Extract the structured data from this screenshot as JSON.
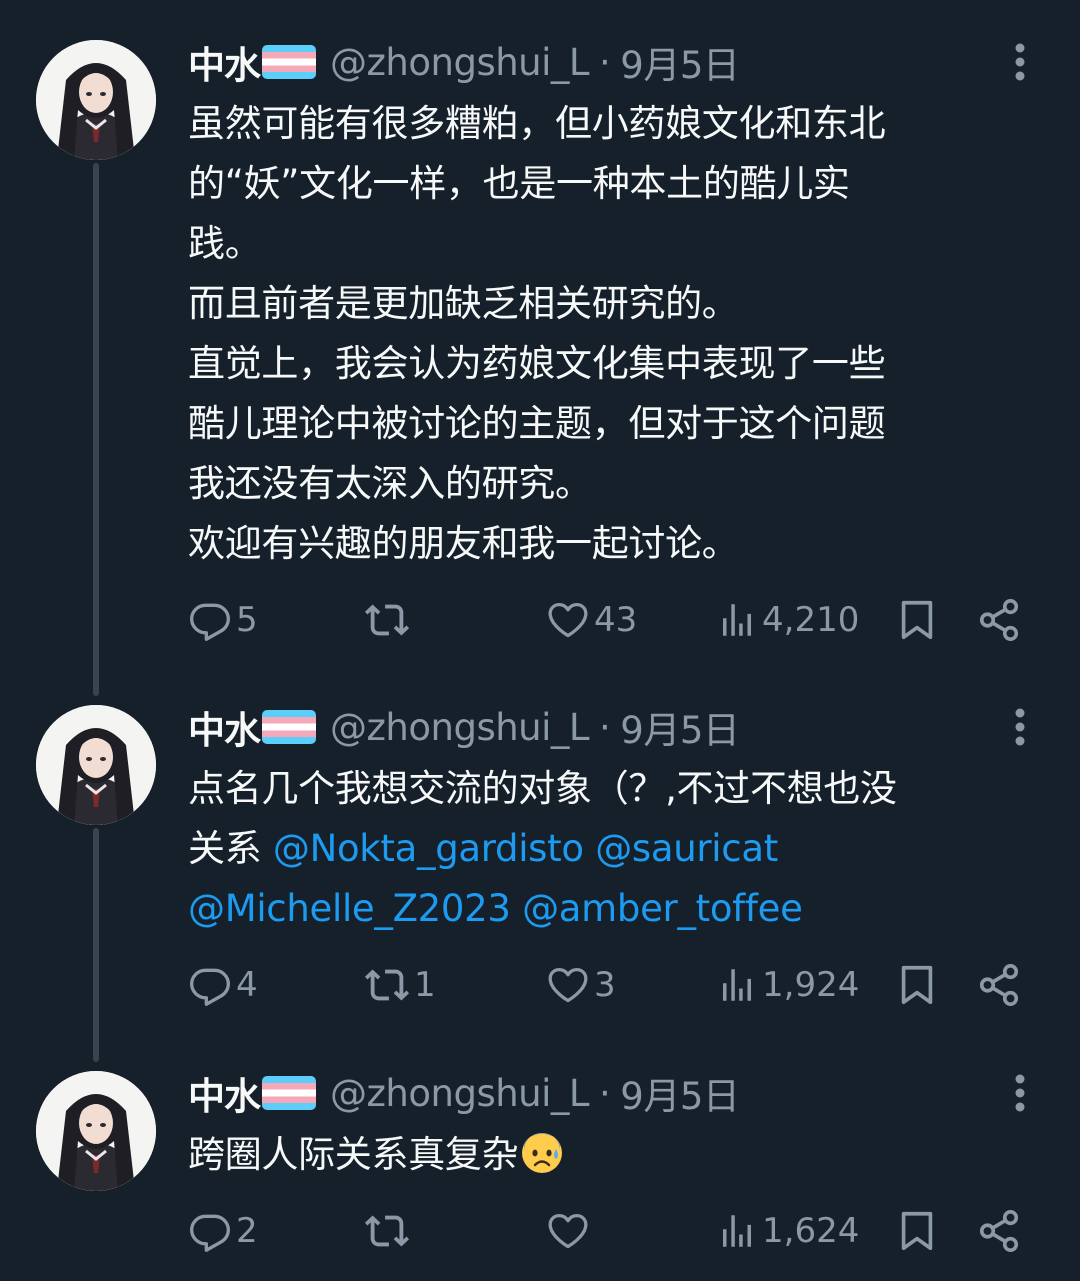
{
  "tweets": [
    {
      "author": {
        "name": "中水",
        "handle": "@zhongshui_L",
        "separator": "·",
        "date": "9月5日",
        "flag_icon": "transgender-flag-icon"
      },
      "lines": [
        "虽然可能有很多糟粕，但小药娘文化和东北",
        "的“妖”文化一样，也是一种本土的酷儿实",
        "践。",
        "而且前者是更加缺乏相关研究的。",
        "直觉上，我会认为药娘文化集中表现了一些",
        "酷儿理论中被讨论的主题，但对于这个问题",
        "我还没有太深入的研究。",
        "欢迎有兴趣的朋友和我一起讨论。"
      ],
      "stats": {
        "replies": "5",
        "retweets": "",
        "likes": "43",
        "views": "4,210"
      }
    },
    {
      "author": {
        "name": "中水",
        "handle": "@zhongshui_L",
        "separator": "·",
        "date": "9月5日",
        "flag_icon": "transgender-flag-icon"
      },
      "line1": "点名几个我想交流的对象（？,不过不想也没",
      "line2_prefix": "关系 ",
      "mentions": [
        "@Nokta_gardisto",
        "@sauricat",
        "@Michelle_Z2023",
        "@amber_toffee"
      ],
      "stats": {
        "replies": "4",
        "retweets": "1",
        "likes": "3",
        "views": "1,924"
      }
    },
    {
      "author": {
        "name": "中水",
        "handle": "@zhongshui_L",
        "separator": "·",
        "date": "9月5日",
        "flag_icon": "transgender-flag-icon"
      },
      "text": "跨圈人际关系真复杂",
      "emoji": "anxious-face-with-sweat-emoji",
      "stats": {
        "replies": "2",
        "retweets": "",
        "likes": "",
        "views": "1,624"
      }
    }
  ],
  "icons": {
    "reply": "reply-icon",
    "retweet": "retweet-icon",
    "like": "like-icon",
    "views": "views-icon",
    "bookmark": "bookmark-icon",
    "share": "share-icon",
    "more": "more-icon"
  },
  "colors": {
    "background": "#15202b",
    "text": "#f7f9f9",
    "secondary": "#8b98a5",
    "link": "#1d9bf0",
    "thread_line": "#38444d"
  }
}
